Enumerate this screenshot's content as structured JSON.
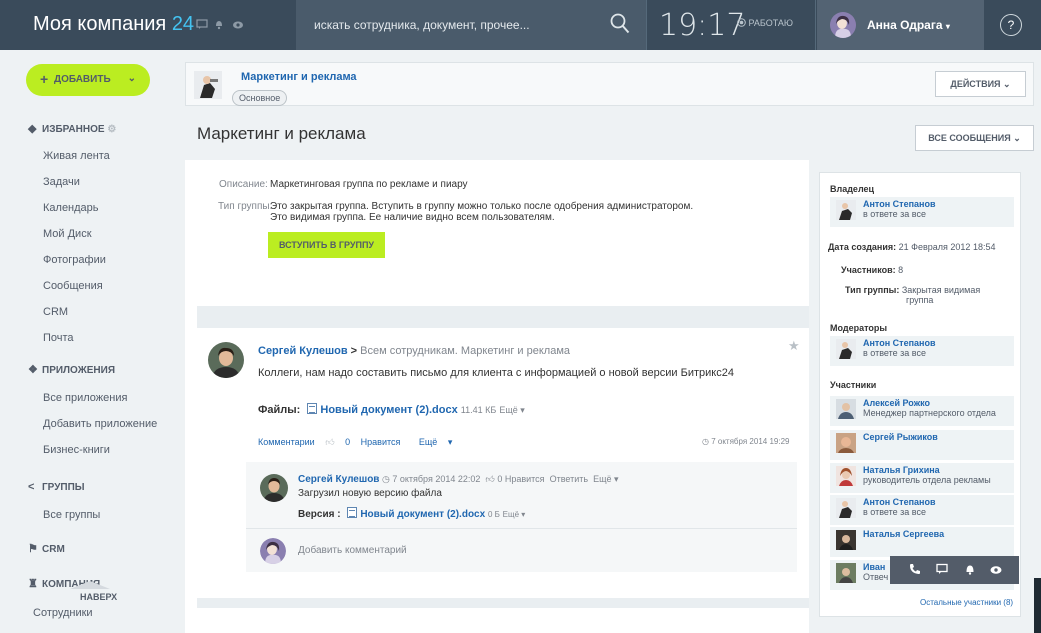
{
  "topbar": {
    "company_name": "Моя компания",
    "company_suffix": "24",
    "search_placeholder": "искать сотрудника, документ, прочее...",
    "time": "19:17",
    "work_status": "РАБОТАЮ",
    "user_name": "Анна Одрага",
    "help": "?",
    "colors": {
      "bar": "#3a4b5b",
      "accent": "#44c3f1"
    }
  },
  "left": {
    "add_button": "ДОБАВИТЬ",
    "favorites": "ИЗБРАННОЕ",
    "fav_items": [
      "Живая лента",
      "Задачи",
      "Календарь",
      "Мой Диск",
      "Фотографии",
      "Сообщения",
      "CRM",
      "Почта"
    ],
    "apps": "ПРИЛОЖЕНИЯ",
    "app_items": [
      "Все приложения",
      "Добавить приложение",
      "Бизнес-книги"
    ],
    "groups": "ГРУППЫ",
    "group_items": [
      "Все группы"
    ],
    "crm": "CRM",
    "company": "КОМПАНИЯ",
    "company_items": [
      "Сотрудники"
    ],
    "back_to_top": "НАВЕРХ"
  },
  "group_header": {
    "name": "Маркетинг и реклама",
    "tag": "Основное",
    "actions_button": "ДЕЙСТВИЯ"
  },
  "page": {
    "title": "Маркетинг и реклама",
    "all_messages_button": "ВСЕ СООБЩЕНИЯ"
  },
  "group_info": {
    "desc_label": "Описание:",
    "desc_value": "Маркетинговая группа по рекламе и пиару",
    "type_label": "Тип группы:",
    "type_line1": "Это закрытая группа. Вступить в группу можно только после одобрения администратором.",
    "type_line2": "Это видимая группа. Ее наличие видно всем пользователям.",
    "join_button": "ВСТУПИТЬ В ГРУППУ"
  },
  "post": {
    "author": "Сергей Кулешов",
    "arrow": ">",
    "recipients": "Всем сотрудникам. Маркетинг и реклама",
    "text": "Коллеги, нам надо составить письмо для клиента с информацией о новой версии Битрикс24",
    "files_label": "Файлы:",
    "file_name": "Новый документ (2).docx",
    "file_size": "11.41 КБ",
    "more": "Ещё",
    "comments_link": "Комментарии",
    "likes": "0",
    "like_label": "Нравится",
    "more_link": "Ещё",
    "date": "7 октября 2014 19:29"
  },
  "comment": {
    "author": "Сергей Кулешов",
    "date": "7 октября 2014 22:02",
    "likes": "0",
    "like_label": "Нравится",
    "reply": "Ответить",
    "more": "Ещё",
    "text": "Загрузил новую версию файла",
    "version_label": "Версия :",
    "file_name": "Новый документ (2).docx",
    "file_size": "0 Б",
    "file_more": "Ещё",
    "add_placeholder": "Добавить комментарий"
  },
  "sidebar": {
    "owner_title": "Владелец",
    "owner": {
      "name": "Антон Степанов",
      "role": "в ответе за все"
    },
    "created_label": "Дата создания:",
    "created_value": "21 Февраля 2012 18:54",
    "members_label": "Участников:",
    "members_value": "8",
    "type_label": "Тип группы:",
    "type_value_1": "Закрытая видимая",
    "type_value_2": "группа",
    "moderators_title": "Модераторы",
    "moderator": {
      "name": "Антон Степанов",
      "role": "в ответе за все"
    },
    "participants_title": "Участники",
    "participants": [
      {
        "name": "Алексей Рожко",
        "role": "Менеджер партнерского отдела"
      },
      {
        "name": "Сергей Рыжиков",
        "role": ""
      },
      {
        "name": "Наталья Грихина",
        "role": "руководитель отдела рекламы"
      },
      {
        "name": "Антон Степанов",
        "role": "в ответе за все"
      },
      {
        "name": "Наталья Сергеева",
        "role": ""
      },
      {
        "name": "Иван",
        "role": "Отвеч"
      }
    ],
    "others_link": "Остальные участники (8)"
  }
}
